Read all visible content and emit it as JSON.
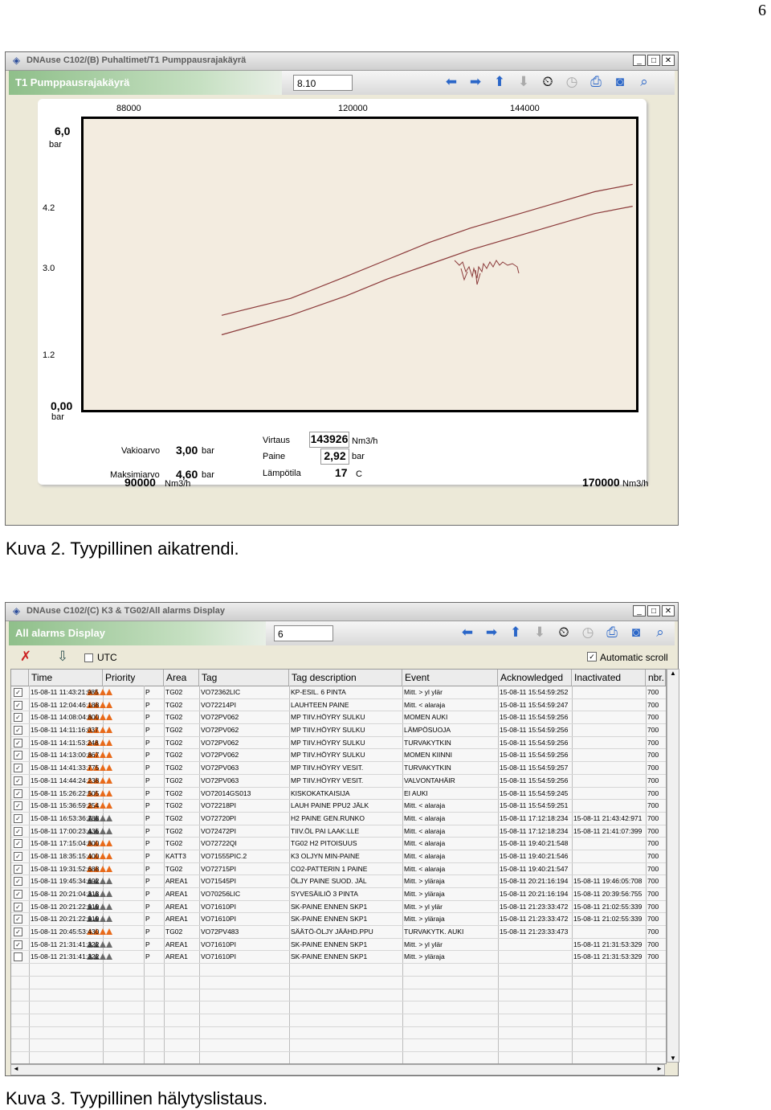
{
  "page_number": "6",
  "caption1": "Kuva 2. Tyypillinen aikatrendi.",
  "caption2": "Kuva 3. Tyypillinen hälytyslistaus.",
  "trend_window": {
    "title": "DNAuse C102/(B) Puhaltimet/T1 Pumppausrajakäyrä",
    "header_title": "T1 Pumppausrajakäyrä",
    "input_value": "8.10",
    "chart_data": {
      "type": "line",
      "x_top_ticks": [
        "88000",
        "120000",
        "144000"
      ],
      "y_ticks": [
        "4.2",
        "3.0",
        "1.2"
      ],
      "y_max_label": "6,0",
      "y_max_unit": "bar",
      "y_min_label": "0,00",
      "y_min_unit": "bar",
      "xlim": [
        90000,
        170000
      ],
      "ylim": [
        0,
        6
      ],
      "x_min_label": "90000",
      "x_max_label": "170000",
      "x_unit": "Nm3/h",
      "series": [
        {
          "x": [
            110000,
            120000,
            128000,
            134000,
            140000,
            146000,
            152000,
            158000,
            164000,
            169500
          ],
          "y": [
            1.95,
            2.3,
            2.75,
            3.1,
            3.45,
            3.75,
            4.0,
            4.25,
            4.5,
            4.65
          ]
        },
        {
          "x": [
            110000,
            120000,
            128000,
            134000,
            140000,
            146000,
            152000,
            158000,
            164000,
            169500
          ],
          "y": [
            1.55,
            1.95,
            2.35,
            2.7,
            3.0,
            3.3,
            3.55,
            3.8,
            4.05,
            4.2
          ]
        }
      ],
      "color": "#8b3a3a"
    },
    "info": {
      "vakioarvo_label": "Vakioarvo",
      "vakioarvo_value": "3,00",
      "vakioarvo_unit": "bar",
      "maksimiarvo_label": "Maksimiarvo",
      "maksimiarvo_value": "4,60",
      "maksimiarvo_unit": "bar",
      "virtaus_label": "Virtaus",
      "virtaus_value": "143926",
      "virtaus_unit": "Nm3/h",
      "paine_label": "Paine",
      "paine_value": "2,92",
      "paine_unit": "bar",
      "lampotila_label": "Lämpötila",
      "lampotila_value": "17",
      "lampotila_unit": "C"
    }
  },
  "alarm_window": {
    "title": "DNAuse C102/(C) K3 & TG02/All alarms Display",
    "header_title": "All alarms Display",
    "input_value": "6",
    "utc_label": "UTC",
    "auto_scroll_label": "Automatic scroll",
    "columns": [
      "Time",
      "Priority",
      "Area",
      "Tag",
      "Tag description",
      "Event",
      "Acknowledged",
      "Inactivated",
      "nbr."
    ],
    "rows": [
      {
        "checked": true,
        "time": "15-08-11 11:43:21:985",
        "pri": "o",
        "p": "P",
        "area": "TG02",
        "tag": "VO72362LIC",
        "desc": "KP-ESIL. 6 PINTA",
        "event": "Mitt. > yl ylär",
        "ack": "15-08-11 15:54:59:252",
        "inact": "",
        "nbr": "700"
      },
      {
        "checked": true,
        "time": "15-08-11 12:04:46:188",
        "pri": "o",
        "p": "P",
        "area": "TG02",
        "tag": "VO72214PI",
        "desc": "LAUHTEEN PAINE",
        "event": "Mitt. < alaraja",
        "ack": "15-08-11 15:54:59:247",
        "inact": "",
        "nbr": "700"
      },
      {
        "checked": true,
        "time": "15-08-11 14:08:04:800",
        "pri": "o",
        "p": "P",
        "area": "TG02",
        "tag": "VO72PV062",
        "desc": "MP TIIV.HÖYRY SULKU",
        "event": "MOMEN AUKI",
        "ack": "15-08-11 15:54:59:256",
        "inact": "",
        "nbr": "700"
      },
      {
        "checked": true,
        "time": "15-08-11 14:11:16:037",
        "pri": "o",
        "p": "P",
        "area": "TG02",
        "tag": "VO72PV062",
        "desc": "MP TIIV.HÖYRY SULKU",
        "event": "LÄMPÖSUOJA",
        "ack": "15-08-11 15:54:59:256",
        "inact": "",
        "nbr": "700"
      },
      {
        "checked": true,
        "time": "15-08-11 14:11:53:248",
        "pri": "o",
        "p": "P",
        "area": "TG02",
        "tag": "VO72PV062",
        "desc": "MP TIIV.HÖYRY SULKU",
        "event": "TURVAKYTKIN",
        "ack": "15-08-11 15:54:59:256",
        "inact": "",
        "nbr": "700"
      },
      {
        "checked": true,
        "time": "15-08-11 14:13:00:867",
        "pri": "o",
        "p": "P",
        "area": "TG02",
        "tag": "VO72PV062",
        "desc": "MP TIIV.HÖYRY SULKU",
        "event": "MOMEN KIINNI",
        "ack": "15-08-11 15:54:59:256",
        "inact": "",
        "nbr": "700"
      },
      {
        "checked": true,
        "time": "15-08-11 14:41:33:775",
        "pri": "o",
        "p": "P",
        "area": "TG02",
        "tag": "VO72PV063",
        "desc": "MP TIIV.HÖYRY VESIT.",
        "event": "TURVAKYTKIN",
        "ack": "15-08-11 15:54:59:257",
        "inact": "",
        "nbr": "700"
      },
      {
        "checked": true,
        "time": "15-08-11 14:44:24:238",
        "pri": "o",
        "p": "P",
        "area": "TG02",
        "tag": "VO72PV063",
        "desc": "MP TIIV.HÖYRY VESIT.",
        "event": "VALVONTAHÄIR",
        "ack": "15-08-11 15:54:59:256",
        "inact": "",
        "nbr": "700"
      },
      {
        "checked": true,
        "time": "15-08-11 15:26:22:505",
        "pri": "o",
        "p": "P",
        "area": "TG02",
        "tag": "VO72014GS013",
        "desc": "KISKOKATKAISIJA",
        "event": "EI AUKI",
        "ack": "15-08-11 15:54:59:245",
        "inact": "",
        "nbr": "700"
      },
      {
        "checked": true,
        "time": "15-08-11 15:36:59:254",
        "pri": "o",
        "p": "P",
        "area": "TG02",
        "tag": "VO72218PI",
        "desc": "LAUH PAINE PPU2 JÄLK",
        "event": "Mitt. < alaraja",
        "ack": "15-08-11 15:54:59:251",
        "inact": "",
        "nbr": "700"
      },
      {
        "checked": true,
        "time": "15-08-11 16:53:36:788",
        "pri": "g",
        "p": "P",
        "area": "TG02",
        "tag": "VO72720PI",
        "desc": "H2 PAINE GEN.RUNKO",
        "event": "Mitt. < alaraja",
        "ack": "15-08-11 17:12:18:234",
        "inact": "15-08-11 21:43:42:971",
        "nbr": "700"
      },
      {
        "checked": true,
        "time": "15-08-11 17:00:23:436",
        "pri": "g",
        "p": "P",
        "area": "TG02",
        "tag": "VO72472PI",
        "desc": "TIIV.ÖL PAI LAAK:LLE",
        "event": "Mitt. < alaraja",
        "ack": "15-08-11 17:12:18:234",
        "inact": "15-08-11 21:41:07:399",
        "nbr": "700"
      },
      {
        "checked": true,
        "time": "15-08-11 17:15:04:800",
        "pri": "o",
        "p": "P",
        "area": "TG02",
        "tag": "VO72722QI",
        "desc": "TG02 H2 PITOISUUS",
        "event": "Mitt. < alaraja",
        "ack": "15-08-11 19:40:21:548",
        "inact": "",
        "nbr": "700"
      },
      {
        "checked": true,
        "time": "15-08-11 18:35:15:400",
        "pri": "o",
        "p": "P",
        "area": "KATT3",
        "tag": "VO71555PIC.2",
        "desc": "K3 OLJYN MIN-PAINE",
        "event": "Mitt. < alaraja",
        "ack": "15-08-11 19:40:21:546",
        "inact": "",
        "nbr": "700"
      },
      {
        "checked": true,
        "time": "15-08-11 19:31:52:688",
        "pri": "o",
        "p": "P",
        "area": "TG02",
        "tag": "VO72715PI",
        "desc": "CO2-PATTERIN 1 PAINE",
        "event": "Mitt. < alaraja",
        "ack": "15-08-11 19:40:21:547",
        "inact": "",
        "nbr": "700"
      },
      {
        "checked": true,
        "time": "15-08-11 19:45:34:692",
        "pri": "g",
        "p": "P",
        "area": "AREA1",
        "tag": "VO71545PI",
        "desc": "ÖLJY PAINE SUOD. JÄL",
        "event": "Mitt. > yläraja",
        "ack": "15-08-11 20:21:16:194",
        "inact": "15-08-11 19:46:05:708",
        "nbr": "700"
      },
      {
        "checked": true,
        "time": "15-08-11 20:21:04:313",
        "pri": "g",
        "p": "P",
        "area": "AREA1",
        "tag": "VO70256LIC",
        "desc": "SYVESÄILIÖ 3 PINTA",
        "event": "Mitt. > yläraja",
        "ack": "15-08-11 20:21:16:194",
        "inact": "15-08-11 20:39:56:755",
        "nbr": "700"
      },
      {
        "checked": true,
        "time": "15-08-11 20:21:22:919",
        "pri": "g",
        "p": "P",
        "area": "AREA1",
        "tag": "VO71610PI",
        "desc": "SK-PAINE ENNEN SKP1",
        "event": "Mitt. > yl ylär",
        "ack": "15-08-11 21:23:33:472",
        "inact": "15-08-11 21:02:55:339",
        "nbr": "700"
      },
      {
        "checked": true,
        "time": "15-08-11 20:21:22:919",
        "pri": "g",
        "p": "P",
        "area": "AREA1",
        "tag": "VO71610PI",
        "desc": "SK-PAINE ENNEN SKP1",
        "event": "Mitt. > yläraja",
        "ack": "15-08-11 21:23:33:472",
        "inact": "15-08-11 21:02:55:339",
        "nbr": "700"
      },
      {
        "checked": true,
        "time": "15-08-11 20:45:53:430",
        "pri": "o",
        "p": "P",
        "area": "TG02",
        "tag": "VO72PV483",
        "desc": "SÄÄTÖ-ÖLJY JÄÄHD.PPU",
        "event": "TURVAKYTK. AUKI",
        "ack": "15-08-11 21:23:33:473",
        "inact": "",
        "nbr": "700"
      },
      {
        "checked": true,
        "time": "15-08-11 21:31:41:322",
        "pri": "g",
        "p": "P",
        "area": "AREA1",
        "tag": "VO71610PI",
        "desc": "SK-PAINE ENNEN SKP1",
        "event": "Mitt. > yl ylär",
        "ack": "",
        "inact": "15-08-11 21:31:53:329",
        "nbr": "700"
      },
      {
        "checked": false,
        "time": "15-08-11 21:31:41:322",
        "pri": "g",
        "p": "P",
        "area": "AREA1",
        "tag": "VO71610PI",
        "desc": "SK-PAINE ENNEN SKP1",
        "event": "Mitt. > yläraja",
        "ack": "",
        "inact": "15-08-11 21:31:53:329",
        "nbr": "700"
      }
    ]
  }
}
